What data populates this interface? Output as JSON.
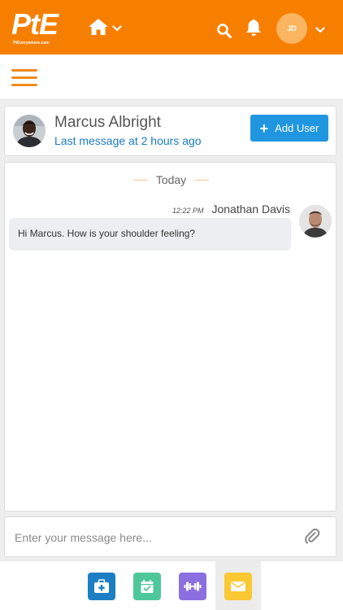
{
  "brand": {
    "logo_text": "PtE",
    "logo_subtext": "PtEverywhere.com"
  },
  "header": {
    "user_initials": "JD"
  },
  "contact": {
    "name": "Marcus Albright",
    "status": "Last message at 2 hours ago",
    "add_user_label": "Add User"
  },
  "conversation": {
    "day_label": "Today",
    "messages": [
      {
        "time": "12:22 PM",
        "author": "Jonathan Davis",
        "text": "Hi Marcus. How is your shoulder feeling?"
      }
    ]
  },
  "composer": {
    "placeholder": "Enter your message here...",
    "value": ""
  },
  "bottom_nav": [
    {
      "icon": "medical-kit-icon",
      "color": "#1c7fc4",
      "active": false
    },
    {
      "icon": "calendar-check-icon",
      "color": "#4ec89a",
      "active": false
    },
    {
      "icon": "dumbbell-icon",
      "color": "#8b6fe0",
      "active": false
    },
    {
      "icon": "envelope-icon",
      "color": "#f9c833",
      "active": true
    }
  ],
  "colors": {
    "brand_orange": "#f77f00",
    "link_blue": "#1a7dc4",
    "button_blue": "#2196e0"
  }
}
